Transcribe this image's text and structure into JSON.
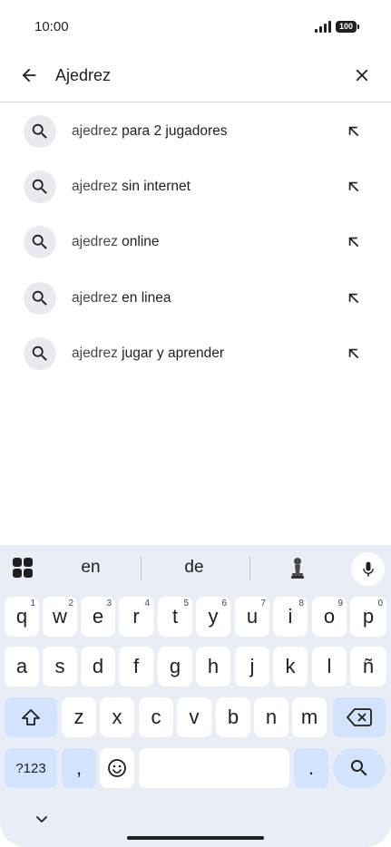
{
  "status_bar": {
    "time": "10:00",
    "battery": "100"
  },
  "search": {
    "query": "Ajedrez",
    "placeholder": ""
  },
  "suggestions": [
    {
      "prefix": "ajedrez",
      "suffix": " para 2 jugadores"
    },
    {
      "prefix": "ajedrez",
      "suffix": " sin internet"
    },
    {
      "prefix": "ajedrez",
      "suffix": " online"
    },
    {
      "prefix": "ajedrez",
      "suffix": " en linea"
    },
    {
      "prefix": "ajedrez",
      "suffix": " jugar y aprender"
    }
  ],
  "keyboard": {
    "word_suggestions": [
      "en",
      "de"
    ],
    "row1": [
      {
        "key": "q",
        "hint": "1"
      },
      {
        "key": "w",
        "hint": "2"
      },
      {
        "key": "e",
        "hint": "3"
      },
      {
        "key": "r",
        "hint": "4"
      },
      {
        "key": "t",
        "hint": "5"
      },
      {
        "key": "y",
        "hint": "6"
      },
      {
        "key": "u",
        "hint": "7"
      },
      {
        "key": "i",
        "hint": "8"
      },
      {
        "key": "o",
        "hint": "9"
      },
      {
        "key": "p",
        "hint": "0"
      }
    ],
    "row2": [
      "a",
      "s",
      "d",
      "f",
      "g",
      "h",
      "j",
      "k",
      "l",
      "ñ"
    ],
    "row3": [
      "z",
      "x",
      "c",
      "v",
      "b",
      "n",
      "m"
    ],
    "symbols_label": "?123",
    "comma_label": ",",
    "period_label": "."
  },
  "colors": {
    "accent_key": "#d3e3fd",
    "keyboard_bg": "#e9eef6",
    "suggestion_icon_bg": "#e8eaf0"
  }
}
